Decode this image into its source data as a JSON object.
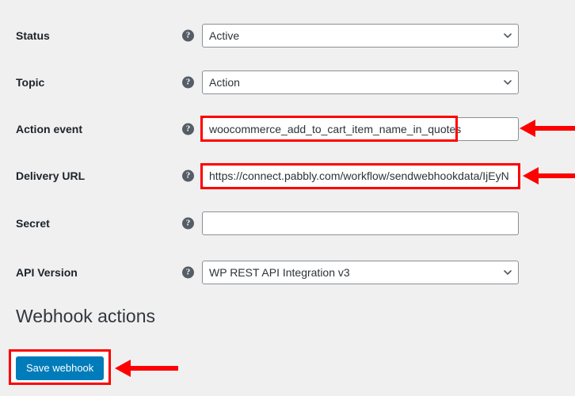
{
  "page": {
    "background_color": "#f0f0f1",
    "accent_color": "#007cba",
    "annotation_color": "#ff0000"
  },
  "form": {
    "help_icon_glyph": "?",
    "rows": [
      {
        "label": "Status",
        "control": "select",
        "value": "Active",
        "help_icon": "help-icon"
      },
      {
        "label": "Topic",
        "control": "select",
        "value": "Action",
        "help_icon": "help-icon"
      },
      {
        "label": "Action event",
        "control": "text",
        "value": "woocommerce_add_to_cart_item_name_in_quotes",
        "placeholder": "",
        "help_icon": "help-icon"
      },
      {
        "label": "Delivery URL",
        "control": "text",
        "value": "https://connect.pabbly.com/workflow/sendwebhookdata/IjEyN",
        "placeholder": "",
        "help_icon": "help-icon"
      },
      {
        "label": "Secret",
        "control": "text",
        "value": "",
        "placeholder": "",
        "help_icon": "help-icon"
      },
      {
        "label": "API Version",
        "control": "select",
        "value": "WP REST API Integration v3",
        "help_icon": "help-icon"
      }
    ]
  },
  "webhook_actions": {
    "heading": "Webhook actions",
    "save_label": "Save webhook"
  },
  "annotations": {
    "action_event_box": "highlight-rectangle",
    "delivery_url_box": "highlight-rectangle",
    "save_button_box": "highlight-rectangle",
    "action_event_arrow": "arrow-pointing-left",
    "delivery_url_arrow": "arrow-pointing-left",
    "save_button_arrow": "arrow-pointing-left"
  }
}
